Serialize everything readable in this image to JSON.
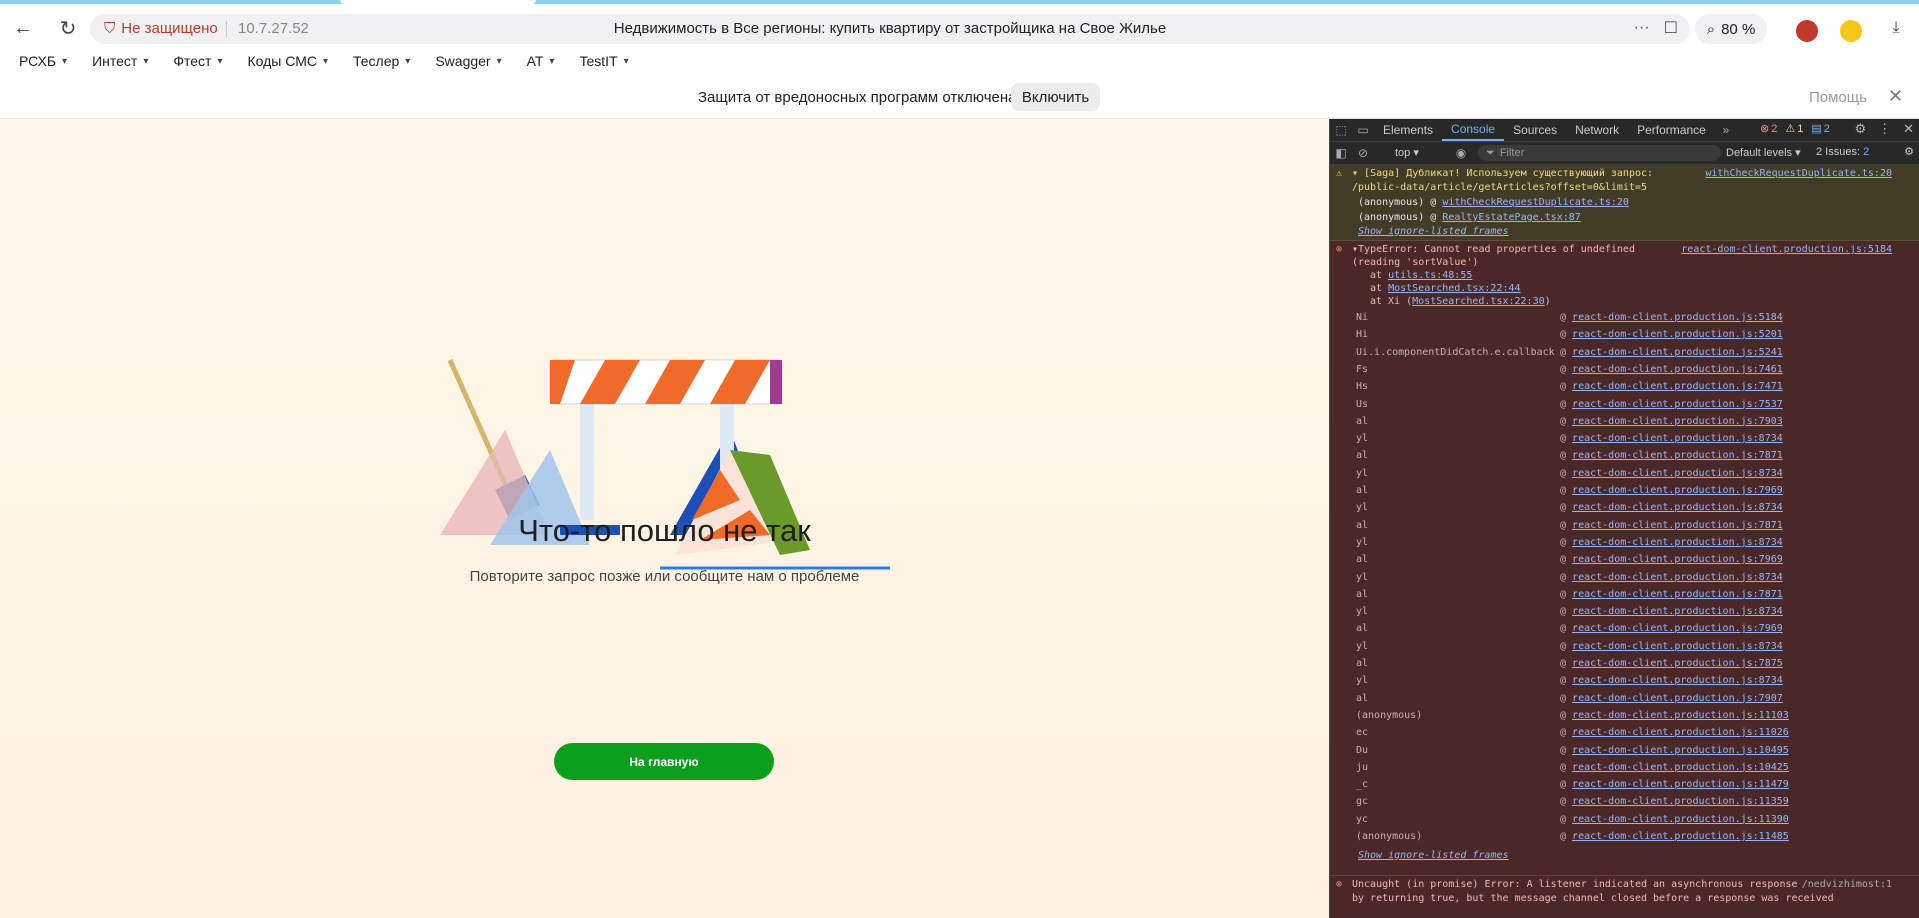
{
  "browser": {
    "security_label": "Не защищено",
    "url": "10.7.27.52",
    "page_title": "Недвижимость в Все регионы: купить квартиру от застройщика на Свое Жилье",
    "zoom": "80 %"
  },
  "bookmarks": [
    {
      "label": "РСХБ"
    },
    {
      "label": "Интест"
    },
    {
      "label": "Фтест"
    },
    {
      "label": "Коды СМС"
    },
    {
      "label": "Теслер"
    },
    {
      "label": "Swagger"
    },
    {
      "label": "АТ"
    },
    {
      "label": "TestIT"
    }
  ],
  "infobar": {
    "message": "Защита от вредоносных программ отключена",
    "enable_label": "Включить",
    "help_label": "Помощь"
  },
  "page": {
    "title": "Что-то пошло не так",
    "subtitle": "Повторите запрос позже или сообщите нам о проблеме",
    "home_button": "На главную"
  },
  "devtools": {
    "tabs": [
      "Elements",
      "Console",
      "Sources",
      "Network",
      "Performance"
    ],
    "active_tab": "Console",
    "errors_count": "2",
    "warnings_count": "1",
    "messages_count": "2",
    "context": "top",
    "filter_placeholder": "Filter",
    "levels": "Default levels",
    "issues_label": "2 Issues:",
    "issues_count": "2",
    "warning": {
      "line1": "[Saga] Дубликат! Используем существующий запрос:",
      "line2": "/public-data/article/getArticles?offset=0&limit=5",
      "source": "withCheckRequestDuplicate.ts:20",
      "frame1_prefix": "(anonymous) @",
      "frame1_link": "withCheckRequestDuplicate.ts:20",
      "frame2_prefix": "(anonymous) @",
      "frame2_link": "RealtyEstatePage.tsx:87",
      "show_frames": "Show ignore-listed frames"
    },
    "error": {
      "line1": "TypeError: Cannot read properties of undefined",
      "line2": "(reading 'sortValue')",
      "source": "react-dom-client.production.js:5184",
      "at1_prefix": "at",
      "at1_link": "utils.ts:48:55",
      "at2_prefix": "at",
      "at2_link": "MostSearched.tsx:22:44",
      "at3_prefix": "at Xi (",
      "at3_link": "MostSearched.tsx:22:30",
      "at3_suffix": ")",
      "show_frames": "Show ignore-listed frames",
      "stack": [
        {
          "fn": "Ni",
          "loc": "react-dom-client.production.js:5184"
        },
        {
          "fn": "Hi",
          "loc": "react-dom-client.production.js:5201"
        },
        {
          "fn": "Ui.i.componentDidCatch.e.callback",
          "loc": "react-dom-client.production.js:5241"
        },
        {
          "fn": "Fs",
          "loc": "react-dom-client.production.js:7461"
        },
        {
          "fn": "Hs",
          "loc": "react-dom-client.production.js:7471"
        },
        {
          "fn": "Us",
          "loc": "react-dom-client.production.js:7537"
        },
        {
          "fn": "al",
          "loc": "react-dom-client.production.js:7903"
        },
        {
          "fn": "yl",
          "loc": "react-dom-client.production.js:8734"
        },
        {
          "fn": "al",
          "loc": "react-dom-client.production.js:7871"
        },
        {
          "fn": "yl",
          "loc": "react-dom-client.production.js:8734"
        },
        {
          "fn": "al",
          "loc": "react-dom-client.production.js:7969"
        },
        {
          "fn": "yl",
          "loc": "react-dom-client.production.js:8734"
        },
        {
          "fn": "al",
          "loc": "react-dom-client.production.js:7871"
        },
        {
          "fn": "yl",
          "loc": "react-dom-client.production.js:8734"
        },
        {
          "fn": "al",
          "loc": "react-dom-client.production.js:7969"
        },
        {
          "fn": "yl",
          "loc": "react-dom-client.production.js:8734"
        },
        {
          "fn": "al",
          "loc": "react-dom-client.production.js:7871"
        },
        {
          "fn": "yl",
          "loc": "react-dom-client.production.js:8734"
        },
        {
          "fn": "al",
          "loc": "react-dom-client.production.js:7969"
        },
        {
          "fn": "yl",
          "loc": "react-dom-client.production.js:8734"
        },
        {
          "fn": "al",
          "loc": "react-dom-client.production.js:7875"
        },
        {
          "fn": "yl",
          "loc": "react-dom-client.production.js:8734"
        },
        {
          "fn": "al",
          "loc": "react-dom-client.production.js:7907"
        },
        {
          "fn": "(anonymous)",
          "loc": "react-dom-client.production.js:11103"
        },
        {
          "fn": "ec",
          "loc": "react-dom-client.production.js:11026"
        },
        {
          "fn": "Du",
          "loc": "react-dom-client.production.js:10495"
        },
        {
          "fn": "ju",
          "loc": "react-dom-client.production.js:10425"
        },
        {
          "fn": "_c",
          "loc": "react-dom-client.production.js:11479"
        },
        {
          "fn": "gc",
          "loc": "react-dom-client.production.js:11359"
        },
        {
          "fn": "yc",
          "loc": "react-dom-client.production.js:11390"
        },
        {
          "fn": "(anonymous)",
          "loc": "react-dom-client.production.js:11485"
        }
      ]
    },
    "error2": {
      "line1": "Uncaught (in promise) Error: A listener indicated an asynchronous response",
      "line2": "by returning true, but the message channel closed before a response was received",
      "source": "/nedvizhimost:1"
    }
  }
}
